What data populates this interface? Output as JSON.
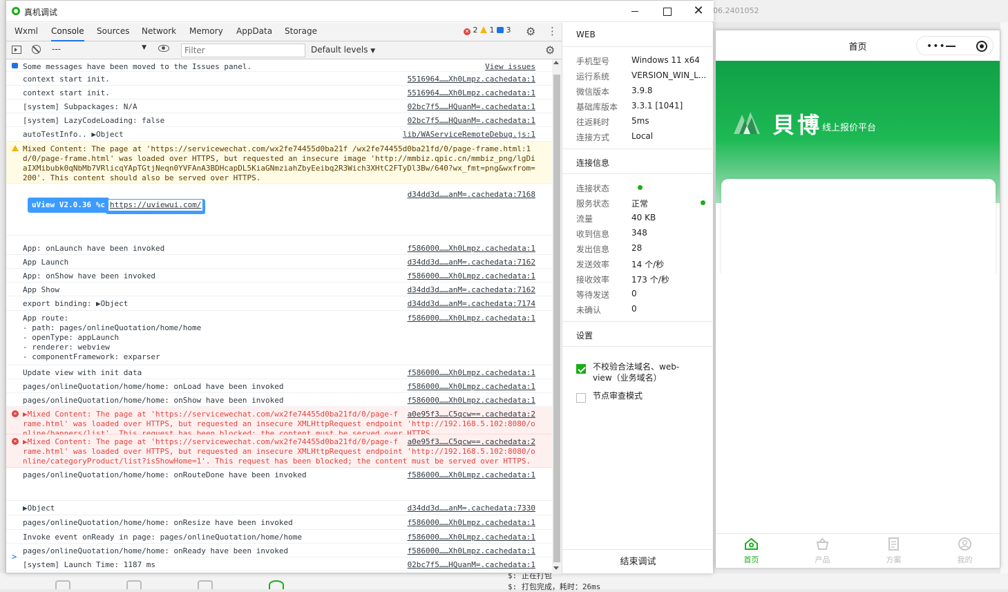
{
  "window": {
    "title": "真机调试"
  },
  "background": {
    "version_fragment": "06.2401052",
    "terminal_lines": [
      "$: 正在打包",
      "$: 打包完成，耗时：26ms"
    ]
  },
  "tabs": [
    {
      "label": "Wxml",
      "active": false
    },
    {
      "label": "Console",
      "active": true
    },
    {
      "label": "Sources",
      "active": false
    },
    {
      "label": "Network",
      "active": false
    },
    {
      "label": "Memory",
      "active": false
    },
    {
      "label": "AppData",
      "active": false
    },
    {
      "label": "Storage",
      "active": false
    }
  ],
  "counters": {
    "errors": "2",
    "warnings": "1",
    "info": "3"
  },
  "toolbar": {
    "context": "---",
    "filter_placeholder": "Filter",
    "levels": "Default levels"
  },
  "console": {
    "rows": [
      {
        "type": "info",
        "msg": "Some messages have been moved to the Issues panel.",
        "src": "View issues"
      },
      {
        "type": "log",
        "msg": "context start init.",
        "src": "5516964……Xh0Lmpz.cachedata:1"
      },
      {
        "type": "log",
        "msg": "context start init.",
        "src": "5516964……Xh0Lmpz.cachedata:1"
      },
      {
        "type": "log",
        "msg": "[system] Subpackages: N/A",
        "src": "02bc7f5……HQuanM=.cachedata:1"
      },
      {
        "type": "log",
        "msg": "[system] LazyCodeLoading: false",
        "src": "02bc7f5……HQuanM=.cachedata:1"
      },
      {
        "type": "log",
        "msg": "autoTestInfo.. ▶Object",
        "src": "lib/WAServiceRemoteDebug.js:1"
      },
      {
        "type": "warn",
        "msg": "Mixed Content: The page at 'https://servicewechat.com/wx2fe74455d0ba21f /wx2fe74455d0ba21fd/0/page-frame.html:1\nd/0/page-frame.html' was loaded over HTTPS, but requested an insecure image 'http://mmbiz.qpic.cn/mmbiz_png/lgDi\naIXMibubk0qNbMb7VRlicqYApTGtjNeqn0YVFAnA3BDHcapDL5KiaGNmziahZbyEeibq2R3Wich3XHtC2FTyDl3Bw/640?wx_fmt=png&wxfrom=\n200'. This content should also be served over HTTPS.",
        "src": ""
      },
      {
        "type": "log",
        "msg": "",
        "src": "d34dd3d……anM=.cachedata:7168"
      },
      {
        "type": "log",
        "msg": "App: onLaunch have been invoked",
        "src": "f586000……Xh0Lmpz.cachedata:1"
      },
      {
        "type": "log",
        "msg": "App Launch",
        "src": "d34dd3d……anM=.cachedata:7162"
      },
      {
        "type": "log",
        "msg": "App: onShow have been invoked",
        "src": "f586000……Xh0Lmpz.cachedata:1"
      },
      {
        "type": "log",
        "msg": "App Show",
        "src": "d34dd3d……anM=.cachedata:7162"
      },
      {
        "type": "log",
        "msg": "export binding: ▶Object",
        "src": "d34dd3d……anM=.cachedata:7174"
      },
      {
        "type": "log",
        "msg": "App route:\n- path: pages/onlineQuotation/home/home\n- openType: appLaunch\n- renderer: webview\n- componentFramework: exparser",
        "src": "f586000……Xh0Lmpz.cachedata:1"
      },
      {
        "type": "log",
        "msg": "Update view with init data",
        "src": "f586000……Xh0Lmpz.cachedata:1"
      },
      {
        "type": "log",
        "msg": "pages/onlineQuotation/home/home: onLoad have been invoked",
        "src": "f586000……Xh0Lmpz.cachedata:1"
      },
      {
        "type": "log",
        "msg": "pages/onlineQuotation/home/home: onShow have been invoked",
        "src": "f586000……Xh0Lmpz.cachedata:1"
      },
      {
        "type": "error",
        "msg": "▶Mixed Content: The page at 'https://servicewechat.com/wx2fe74455d0ba21fd/0/page-f\nrame.html' was loaded over HTTPS, but requested an insecure XMLHttpRequest endpoint 'http://192.168.5.102:8080/o\nnline/banners/list'. This request has been blocked; the content must be served over HTTPS.",
        "src": "a0e95f3……C5qcw==.cachedata:2"
      },
      {
        "type": "error",
        "msg": "▶Mixed Content: The page at 'https://servicewechat.com/wx2fe74455d0ba21fd/0/page-f\nrame.html' was loaded over HTTPS, but requested an insecure XMLHttpRequest endpoint 'http://192.168.5.102:8080/o\nnline/categoryProduct/list?isShowHome=1'. This request has been blocked; the content must be served over HTTPS.",
        "src": "a0e95f3……C5qcw==.cachedata:2"
      },
      {
        "type": "log",
        "msg": "pages/onlineQuotation/home/home: onRouteDone have been invoked",
        "src": "f586000……Xh0Lmpz.cachedata:1"
      },
      {
        "type": "log",
        "msg": "▶Object",
        "src": "d34dd3d……anM=.cachedata:7330"
      },
      {
        "type": "log",
        "msg": "pages/onlineQuotation/home/home: onResize have been invoked",
        "src": "f586000……Xh0Lmpz.cachedata:1"
      },
      {
        "type": "log",
        "msg": "Invoke event onReady in page: pages/onlineQuotation/home/home",
        "src": "f586000……Xh0Lmpz.cachedata:1"
      },
      {
        "type": "log",
        "msg": "pages/onlineQuotation/home/home: onReady have been invoked",
        "src": "f586000……Xh0Lmpz.cachedata:1"
      },
      {
        "type": "log",
        "msg": "[system] Launch Time: 1187 ms",
        "src": "02bc7f5……HQuanM=.cachedata:1"
      }
    ],
    "uview_badge": "uView V2.0.36 %c",
    "uview_link": "https://uviewui.com/",
    "prompt": ">"
  },
  "info_panel": {
    "web_title": "WEB",
    "device": [
      {
        "key": "手机型号",
        "value": "Windows 11 x64"
      },
      {
        "key": "运行系统",
        "value": "VERSION_WIN_L..."
      },
      {
        "key": "微信版本",
        "value": "3.9.8"
      },
      {
        "key": "基础库版本",
        "value": "3.3.1 [1041]"
      },
      {
        "key": "往返耗时",
        "value": "5ms"
      },
      {
        "key": "连接方式",
        "value": "Local"
      }
    ],
    "conn_title": "连接信息",
    "conn": [
      {
        "key": "连接状态",
        "value": ""
      },
      {
        "key": "服务状态",
        "value": "正常"
      },
      {
        "key": "流量",
        "value": "40 KB"
      },
      {
        "key": "收到信息",
        "value": "348"
      },
      {
        "key": "发出信息",
        "value": "28"
      },
      {
        "key": "发送效率",
        "value": "14 个/秒"
      },
      {
        "key": "接收效率",
        "value": "173 个/秒"
      },
      {
        "key": "等待发送",
        "value": "0"
      },
      {
        "key": "未确认",
        "value": "0"
      }
    ],
    "settings_title": "设置",
    "settings": [
      {
        "label": "不校验合法域名、web-view（业务域名）",
        "checked": true
      },
      {
        "label": "节点审查模式",
        "checked": false
      }
    ],
    "end_debug": "结束调试",
    "status_color": "#1aad19"
  },
  "simulator": {
    "nav_title": "首页",
    "logo_cn": "貝博",
    "logo_sub": "线上报价平台",
    "tabs": [
      {
        "label": "首页",
        "icon": "home-icon",
        "active": true
      },
      {
        "label": "产品",
        "icon": "basket-icon",
        "active": false
      },
      {
        "label": "方案",
        "icon": "document-icon",
        "active": false
      },
      {
        "label": "我的",
        "icon": "user-icon",
        "active": false
      }
    ],
    "accent_color": "#1aad19"
  }
}
